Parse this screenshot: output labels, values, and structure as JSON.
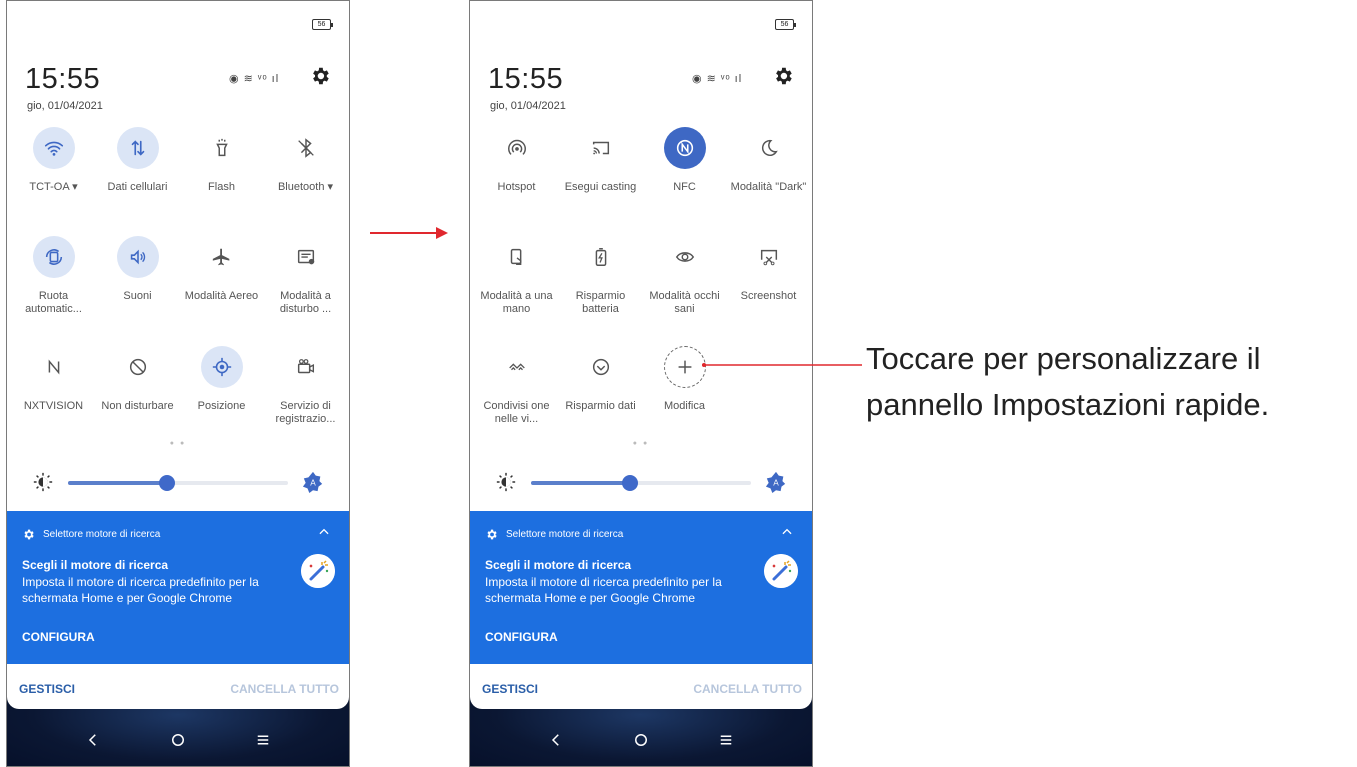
{
  "screens": [
    {
      "battery": "56",
      "time": "15:55",
      "date": "gio, 01/04/2021",
      "status_icons": "◉ ≋ ᵛᵒ ıl",
      "tiles": [
        {
          "label": "TCT-OA ▾",
          "icon": "wifi-icon",
          "on": true
        },
        {
          "label": "Dati cellulari",
          "icon": "mobile-data-icon",
          "on": true
        },
        {
          "label": "Flash",
          "icon": "flashlight-icon",
          "on": false
        },
        {
          "label": "Bluetooth ▾",
          "icon": "bluetooth-icon",
          "on": false
        },
        {
          "label": "Ruota automatic...",
          "icon": "auto-rotate-icon",
          "on": true
        },
        {
          "label": "Suoni",
          "icon": "sound-icon",
          "on": true
        },
        {
          "label": "Modalità Aereo",
          "icon": "airplane-icon",
          "on": false
        },
        {
          "label": "Modalità a disturbo ...",
          "icon": "notification-mode-icon",
          "on": false
        },
        {
          "label": "NXTVISION",
          "icon": "nxtvision-icon",
          "on": false
        },
        {
          "label": "Non disturbare",
          "icon": "do-not-disturb-icon",
          "on": false
        },
        {
          "label": "Posizione",
          "icon": "location-icon",
          "on": true
        },
        {
          "label": "Servizio di registrazio...",
          "icon": "screen-recorder-icon",
          "on": false
        }
      ],
      "brightness_level": 0.45
    },
    {
      "battery": "56",
      "time": "15:55",
      "date": "gio, 01/04/2021",
      "status_icons": "◉ ≋ ᵛᵒ ıl",
      "tiles": [
        {
          "label": "Hotspot",
          "icon": "hotspot-icon",
          "on": false
        },
        {
          "label": "Esegui casting",
          "icon": "cast-icon",
          "on": false
        },
        {
          "label": "NFC",
          "icon": "nfc-icon",
          "on": true
        },
        {
          "label": "Modalità \"Dark\"",
          "icon": "dark-mode-icon",
          "on": false
        },
        {
          "label": "Modalità a una mano",
          "icon": "one-hand-icon",
          "on": false
        },
        {
          "label": "Risparmio batteria",
          "icon": "battery-saver-icon",
          "on": false
        },
        {
          "label": "Modalità occhi sani",
          "icon": "eye-comfort-icon",
          "on": false
        },
        {
          "label": "Screenshot",
          "icon": "screenshot-icon",
          "on": false
        },
        {
          "label": "Condivisi one nelle vi...",
          "icon": "nearby-share-icon",
          "on": false
        },
        {
          "label": "Risparmio dati",
          "icon": "data-saver-icon",
          "on": false
        },
        {
          "label": "Modifica",
          "icon": "edit-plus-icon",
          "on": false
        }
      ],
      "brightness_level": 0.45
    }
  ],
  "notification": {
    "app": "Selettore motore di ricerca",
    "title": "Scegli il motore di ricerca",
    "body": "Imposta il motore di ricerca predefinito per la schermata Home e per Google Chrome",
    "action": "CONFIGURA"
  },
  "actions": {
    "manage": "GESTISCI",
    "clear_all": "CANCELLA TUTTO"
  },
  "callout": {
    "line1": "Toccare per personalizzare il",
    "line2": "pannello Impostazioni rapide."
  },
  "colors": {
    "accent": "#1d6fe0",
    "tile_on": "#dbe5f6",
    "arrow": "#e0282e"
  }
}
